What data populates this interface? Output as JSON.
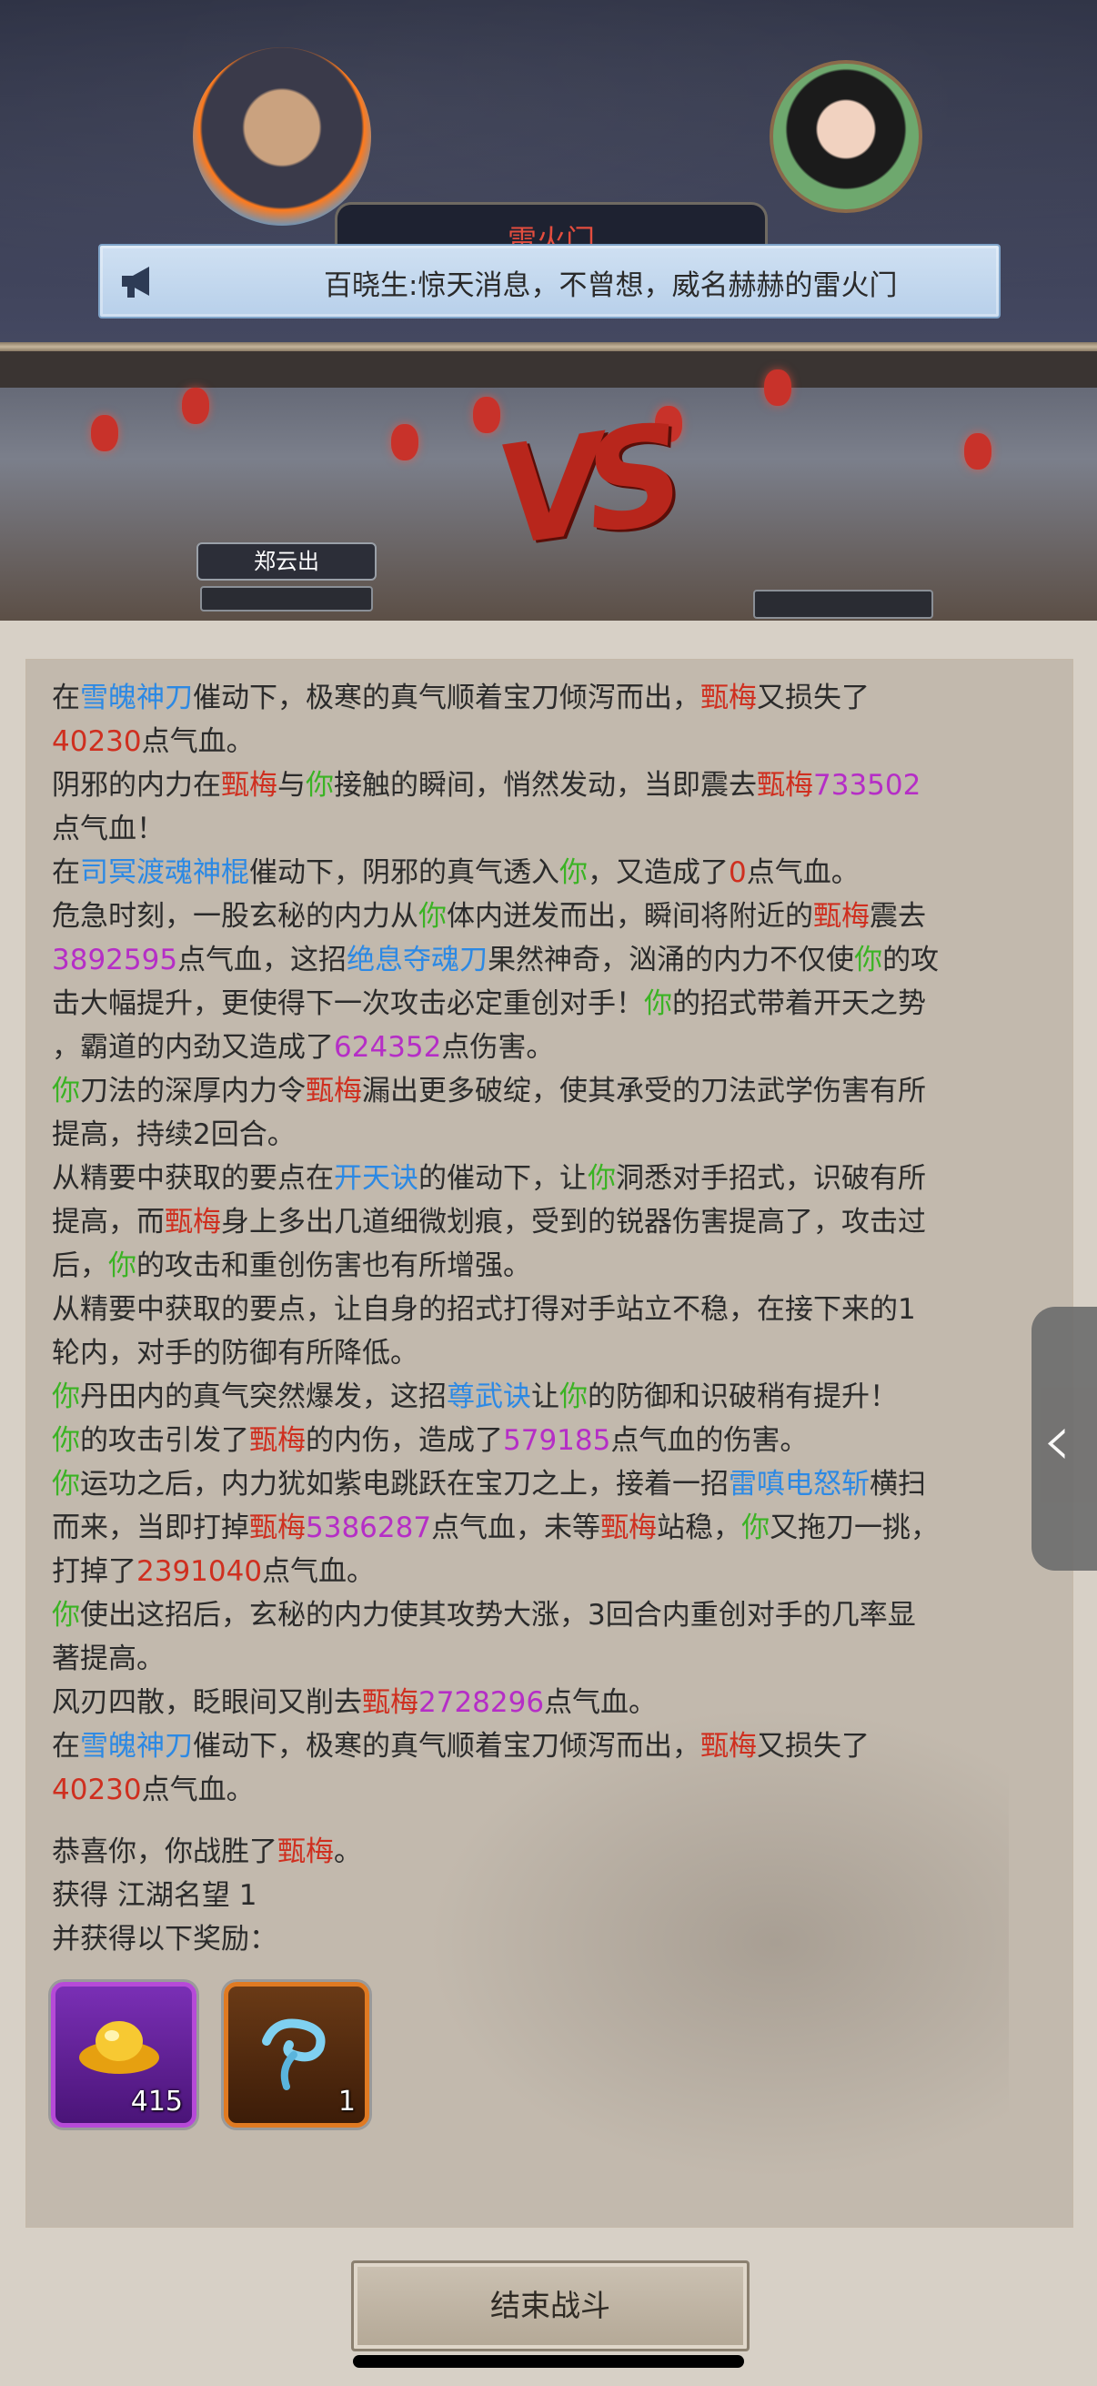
{
  "header": {
    "tab_title": "雷火门",
    "announcement": "百晓生:惊天消息，不曾想，威名赫赫的雷火门"
  },
  "arena": {
    "player_name": "郑云出",
    "vs_text": "VS"
  },
  "battle_log": [
    [
      {
        "t": "在"
      },
      {
        "t": "雪魄神刀",
        "c": "b"
      },
      {
        "t": "催动下，极寒的真气顺着宝刀倾泻而出，"
      },
      {
        "t": "甄梅",
        "c": "r"
      },
      {
        "t": "又损失了"
      }
    ],
    [
      {
        "t": "40230",
        "c": "r"
      },
      {
        "t": "点气血。"
      }
    ],
    [
      {
        "t": "阴邪的内力在"
      },
      {
        "t": "甄梅",
        "c": "r"
      },
      {
        "t": "与"
      },
      {
        "t": "你",
        "c": "g"
      },
      {
        "t": "接触的瞬间，悄然发动，当即震去"
      },
      {
        "t": "甄梅",
        "c": "r"
      },
      {
        "t": "733502",
        "c": "p"
      }
    ],
    [
      {
        "t": "点气血！"
      }
    ],
    [
      {
        "t": "在"
      },
      {
        "t": "司冥渡魂神棍",
        "c": "b"
      },
      {
        "t": "催动下，阴邪的真气透入"
      },
      {
        "t": "你",
        "c": "g"
      },
      {
        "t": "，又造成了"
      },
      {
        "t": "0",
        "c": "r"
      },
      {
        "t": "点气血。"
      }
    ],
    [
      {
        "t": "危急时刻，一股玄秘的内力从"
      },
      {
        "t": "你",
        "c": "g"
      },
      {
        "t": "体内迸发而出，瞬间将附近的"
      },
      {
        "t": "甄梅",
        "c": "r"
      },
      {
        "t": "震去"
      }
    ],
    [
      {
        "t": "3892595",
        "c": "p"
      },
      {
        "t": "点气血，这招"
      },
      {
        "t": "绝息夺魂刀",
        "c": "b"
      },
      {
        "t": "果然神奇，汹涌的内力不仅使"
      },
      {
        "t": "你",
        "c": "g"
      },
      {
        "t": "的攻"
      }
    ],
    [
      {
        "t": "击大幅提升，更使得下一次攻击必定重创对手！"
      },
      {
        "t": "你",
        "c": "g"
      },
      {
        "t": "的招式带着开天之势"
      }
    ],
    [
      {
        "t": "，霸道的内劲又造成了"
      },
      {
        "t": "624352",
        "c": "p"
      },
      {
        "t": "点伤害。"
      }
    ],
    [
      {
        "t": "你",
        "c": "g"
      },
      {
        "t": "刀法的深厚内力令"
      },
      {
        "t": "甄梅",
        "c": "r"
      },
      {
        "t": "漏出更多破绽，使其承受的刀法武学伤害有所"
      }
    ],
    [
      {
        "t": "提高，持续2回合。"
      }
    ],
    [
      {
        "t": "从精要中获取的要点在"
      },
      {
        "t": "开天诀",
        "c": "b"
      },
      {
        "t": "的催动下，让"
      },
      {
        "t": "你",
        "c": "g"
      },
      {
        "t": "洞悉对手招式，识破有所"
      }
    ],
    [
      {
        "t": "提高，而"
      },
      {
        "t": "甄梅",
        "c": "r"
      },
      {
        "t": "身上多出几道细微划痕，受到的锐器伤害提高了，攻击过"
      }
    ],
    [
      {
        "t": "后，"
      },
      {
        "t": "你",
        "c": "g"
      },
      {
        "t": "的攻击和重创伤害也有所增强。"
      }
    ],
    [
      {
        "t": "从精要中获取的要点，让自身的招式打得对手站立不稳，在接下来的1"
      }
    ],
    [
      {
        "t": "轮内，对手的防御有所降低。"
      }
    ],
    [
      {
        "t": "你",
        "c": "g"
      },
      {
        "t": "丹田内的真气突然爆发，这招"
      },
      {
        "t": "尊武诀",
        "c": "b"
      },
      {
        "t": "让"
      },
      {
        "t": "你",
        "c": "g"
      },
      {
        "t": "的防御和识破稍有提升！"
      }
    ],
    [
      {
        "t": "你",
        "c": "g"
      },
      {
        "t": "的攻击引发了"
      },
      {
        "t": "甄梅",
        "c": "r"
      },
      {
        "t": "的内伤，造成了"
      },
      {
        "t": "579185",
        "c": "p"
      },
      {
        "t": "点气血的伤害。"
      }
    ],
    [
      {
        "t": "你",
        "c": "g"
      },
      {
        "t": "运功之后，内力犹如紫电跳跃在宝刀之上，接着一招"
      },
      {
        "t": "雷嗔电怒斩",
        "c": "b"
      },
      {
        "t": "横扫"
      }
    ],
    [
      {
        "t": "而来，当即打掉"
      },
      {
        "t": "甄梅",
        "c": "r"
      },
      {
        "t": "5386287",
        "c": "p"
      },
      {
        "t": "点气血，未等"
      },
      {
        "t": "甄梅",
        "c": "r"
      },
      {
        "t": "站稳，"
      },
      {
        "t": "你",
        "c": "g"
      },
      {
        "t": "又拖刀一挑，"
      }
    ],
    [
      {
        "t": "打掉了"
      },
      {
        "t": "2391040",
        "c": "r"
      },
      {
        "t": "点气血。"
      }
    ],
    [
      {
        "t": "你",
        "c": "g"
      },
      {
        "t": "使出这招后，玄秘的内力使其攻势大涨，3回合内重创对手的几率显"
      }
    ],
    [
      {
        "t": "著提高。"
      }
    ],
    [
      {
        "t": "风刃四散，眨眼间又削去"
      },
      {
        "t": "甄梅",
        "c": "r"
      },
      {
        "t": "2728296",
        "c": "p"
      },
      {
        "t": "点气血。"
      }
    ],
    [
      {
        "t": "在"
      },
      {
        "t": "雪魄神刀",
        "c": "b"
      },
      {
        "t": "催动下，极寒的真气顺着宝刀倾泻而出，"
      },
      {
        "t": "甄梅",
        "c": "r"
      },
      {
        "t": "又损失了"
      }
    ],
    [
      {
        "t": "40230",
        "c": "r"
      },
      {
        "t": "点气血。"
      }
    ],
    "gap",
    [
      {
        "t": "恭喜你，你战胜了"
      },
      {
        "t": "甄梅",
        "c": "r"
      },
      {
        "t": "。"
      }
    ],
    [
      {
        "t": "获得 江湖名望 1"
      }
    ],
    [
      {
        "t": "并获得以下奖励："
      }
    ]
  ],
  "rewards": [
    {
      "icon": "gold-ingot-icon",
      "count": "415"
    },
    {
      "icon": "blue-cloud-icon",
      "count": "1"
    }
  ],
  "end_button_label": "结束战斗",
  "colors": {
    "red": "#cf2f1f",
    "blue": "#2c89e4",
    "green": "#3bb324",
    "purple": "#b52ec6"
  }
}
